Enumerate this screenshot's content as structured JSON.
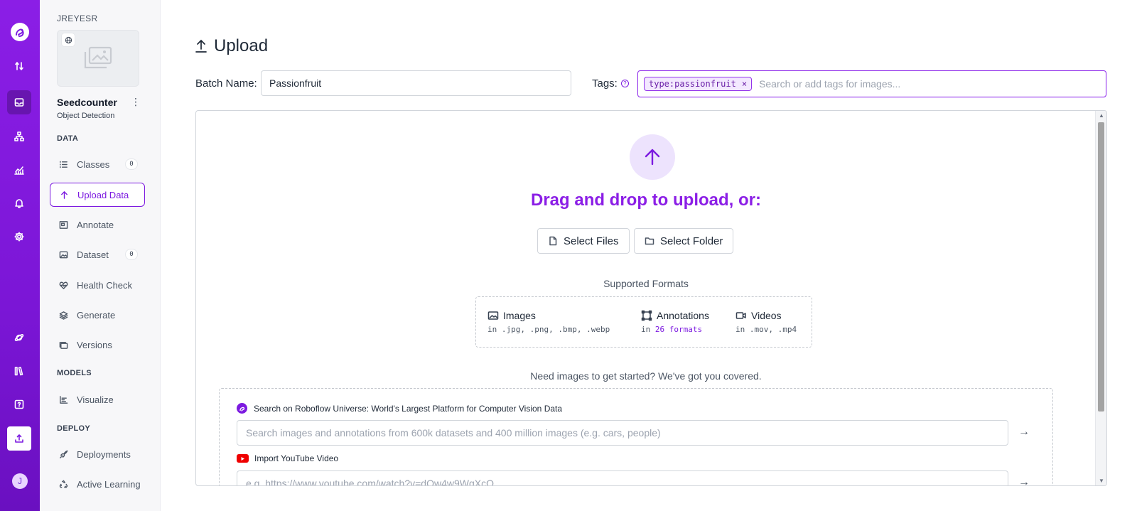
{
  "sidebar": {
    "workspace": "JREYESR",
    "project_name": "Seedcounter",
    "project_type": "Object Detection",
    "sections": {
      "data": "DATA",
      "models": "MODELS",
      "deploy": "DEPLOY"
    },
    "items": [
      {
        "label": "Classes",
        "badge": "0"
      },
      {
        "label": "Upload Data"
      },
      {
        "label": "Annotate"
      },
      {
        "label": "Dataset",
        "badge": "0"
      },
      {
        "label": "Health Check"
      },
      {
        "label": "Generate"
      },
      {
        "label": "Versions"
      },
      {
        "label": "Visualize"
      },
      {
        "label": "Deployments"
      },
      {
        "label": "Active Learning"
      }
    ],
    "active_item": "Upload Data"
  },
  "rail": {
    "icons": [
      "roboflow-logo-icon",
      "transfer-icon",
      "inbox-icon",
      "sitemap-icon",
      "chart-icon",
      "bell-icon",
      "gear-icon",
      "planet-icon",
      "books-icon",
      "help-icon",
      "upload-icon"
    ],
    "avatar_initial": "J"
  },
  "main": {
    "title": "Upload",
    "batch_label": "Batch Name:",
    "batch_value": "Passionfruit",
    "tags_label": "Tags:",
    "tag_chip": "type:passionfruit",
    "tags_placeholder": "Search or add tags for images...",
    "drag_text": "Drag and drop to upload, or:",
    "select_files": "Select Files",
    "select_folder": "Select Folder",
    "supported_label": "Supported Formats",
    "formats": {
      "images_title": "Images",
      "images_sub": "in .jpg, .png, .bmp, .webp",
      "annotations_title": "Annotations",
      "annotations_prefix": "in",
      "annotations_link": "26 formats",
      "videos_title": "Videos",
      "videos_sub": "in .mov, .mp4"
    },
    "need_text": "Need images to get started? We've got you covered.",
    "universe_title": "Search on Roboflow Universe: World's Largest Platform for Computer Vision Data",
    "universe_placeholder": "Search images and annotations from 600k datasets and 400 million images (e.g. cars, people)",
    "youtube_title": "Import YouTube Video",
    "youtube_placeholder": "e.g. https://www.youtube.com/watch?v=dQw4w9WgXcQ"
  },
  "colors": {
    "brand": "#7c1ae0",
    "drag_text": "#8b1ee6",
    "youtube": "#ef0000"
  }
}
